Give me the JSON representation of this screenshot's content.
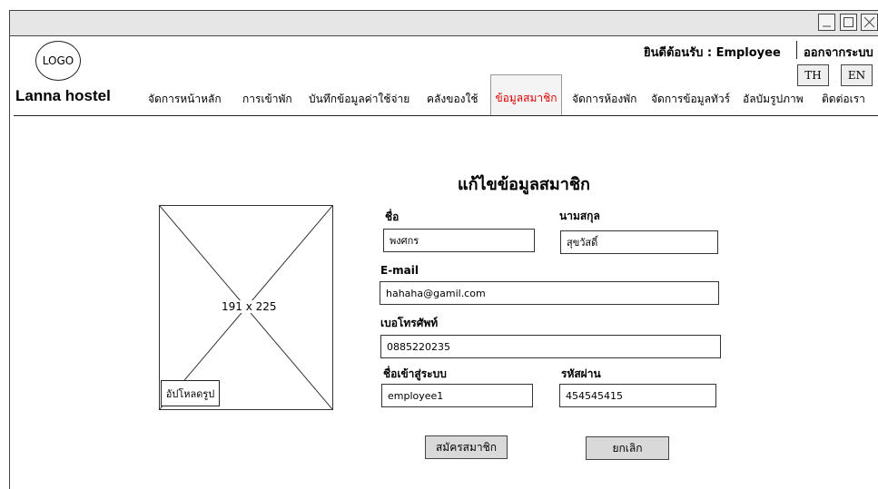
{
  "window": {
    "controls": [
      "minimize-icon",
      "maximize-icon",
      "close-icon"
    ]
  },
  "header": {
    "logo_text": "LOGO",
    "brand": "Lanna hostel",
    "welcome": "ยินดีต้อนรับ : Employee",
    "logout": "ออกจากระบบ",
    "lang_th": "TH",
    "lang_en": "EN"
  },
  "nav": {
    "items": [
      {
        "label": "จัดการหน้าหลัก"
      },
      {
        "label": "การเข้าพัก"
      },
      {
        "label": "บันทึกข้อมูลค่าใช้จ่าย"
      },
      {
        "label": "คลังของใช้"
      },
      {
        "label": "ข้อมูลสมาชิก"
      },
      {
        "label": "จัดการห้องพัก"
      },
      {
        "label": "จัดการข้อมูลทัวร์"
      },
      {
        "label": "อัลบัมรูปภาพ"
      },
      {
        "label": "ติดต่อเรา"
      }
    ],
    "active": "ข้อมูลสมาชิก",
    "active_color": "#e00000"
  },
  "form": {
    "title": "แก้ไขข้อมูลสมาชิก",
    "image_placeholder": "191 x 225",
    "upload_label": "อัปโหลดรูป",
    "first_name_label": "ชื่อ",
    "first_name_value": "พงศกร",
    "last_name_label": "นามสกุล",
    "last_name_value": "สุขวัสดิ์",
    "email_label": "E-mail",
    "email_value": "hahaha@gamil.com",
    "phone_label": "เบอโทรศัพท์",
    "phone_value": "0885220235",
    "username_label": "ชื่อเข้าสู่ระบบ",
    "username_value": "employee1",
    "password_label": "รหัสผ่าน",
    "password_value": "454545415",
    "submit_label": "สมัครสมาชิก",
    "cancel_label": "ยกเลิก"
  }
}
